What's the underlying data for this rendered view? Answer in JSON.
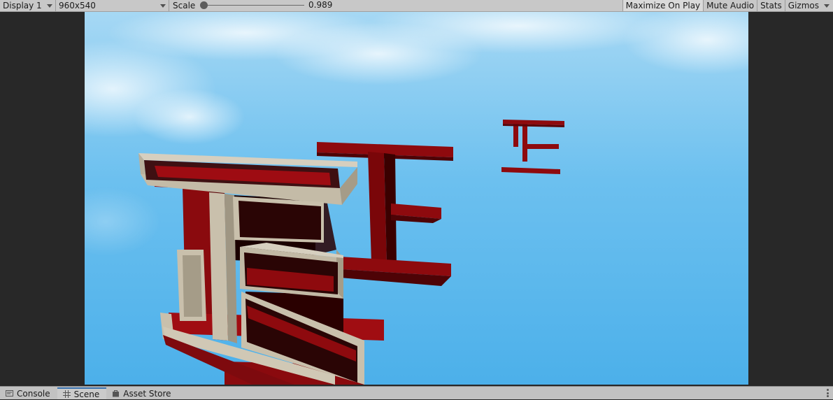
{
  "toolbar": {
    "display_label": "Display 1",
    "resolution_label": "960x540",
    "scale_label": "Scale",
    "scale_value": "0.989",
    "scale_slider_fraction": 0.01,
    "maximize_label": "Maximize On Play",
    "mute_label": "Mute Audio",
    "stats_label": "Stats",
    "gizmos_label": "Gizmos",
    "maximize_active": true
  },
  "viewport": {
    "scene_description_colors": {
      "sky_top": "#9fd3f2",
      "sky_bottom": "#4fb2ea",
      "beam_red": "#8e0a0e",
      "beam_dark": "#3a0000",
      "shelf_outer": "#c2b9a6",
      "shelf_inner": "#8d8676"
    }
  },
  "bottom_tabs": [
    {
      "label": "Console",
      "icon": "console-icon",
      "active": false
    },
    {
      "label": "Scene",
      "icon": "grid-icon",
      "active": true
    },
    {
      "label": "Asset Store",
      "icon": "bag-icon",
      "active": false
    }
  ]
}
